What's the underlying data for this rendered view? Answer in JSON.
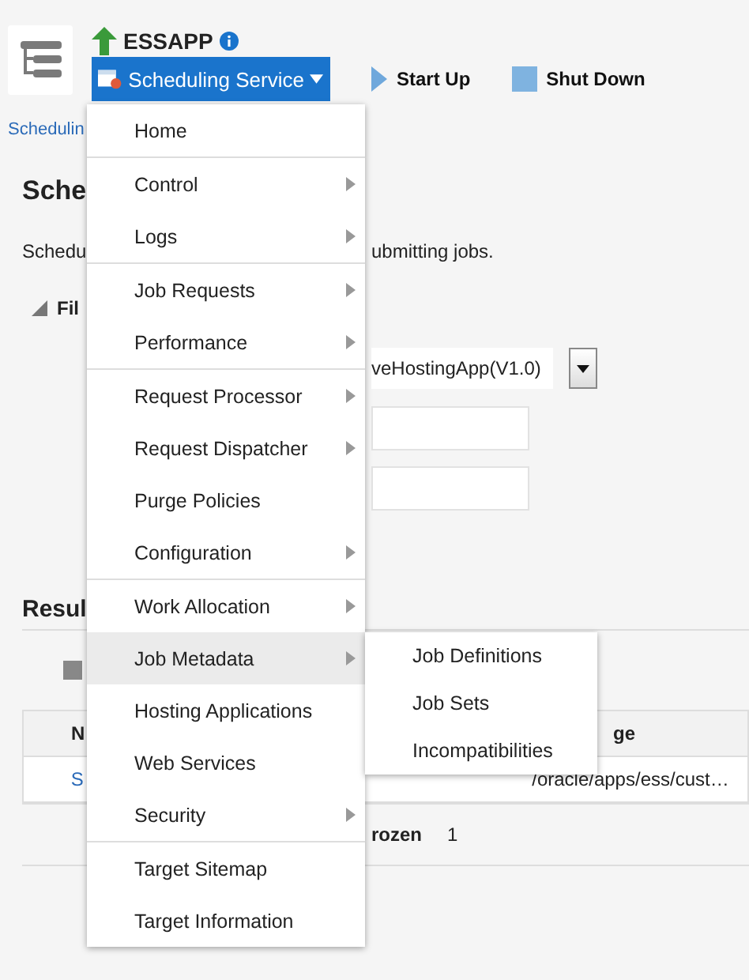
{
  "header": {
    "app_title": "ESSAPP",
    "service_button": "Scheduling Service",
    "actions": [
      {
        "kind": "start",
        "label": "Start Up"
      },
      {
        "kind": "stop",
        "label": "Shut Down"
      }
    ]
  },
  "breadcrumb": "Schedulin",
  "page_title": "Sche",
  "description": {
    "left": "Schedu",
    "right": "ubmitting jobs."
  },
  "filter": {
    "label": "Fil",
    "expanded": true,
    "select_value": "veHostingApp(V1.0)"
  },
  "results": {
    "title": "Resul",
    "headers": [
      "N",
      "ge"
    ],
    "row": [
      "S",
      "/oracle/apps/ess/cust…"
    ],
    "footer": [
      "rozen",
      "1"
    ]
  },
  "menu": {
    "groups": [
      [
        {
          "label": "Home",
          "submenu": false,
          "selected": false
        }
      ],
      [
        {
          "label": "Control",
          "submenu": true,
          "selected": false
        },
        {
          "label": "Logs",
          "submenu": true,
          "selected": false
        }
      ],
      [
        {
          "label": "Job Requests",
          "submenu": true,
          "selected": false
        },
        {
          "label": "Performance",
          "submenu": true,
          "selected": false
        }
      ],
      [
        {
          "label": "Request Processor",
          "submenu": true,
          "selected": false
        },
        {
          "label": "Request Dispatcher",
          "submenu": true,
          "selected": false
        },
        {
          "label": "Purge Policies",
          "submenu": false,
          "selected": false
        },
        {
          "label": "Configuration",
          "submenu": true,
          "selected": false
        }
      ],
      [
        {
          "label": "Work Allocation",
          "submenu": true,
          "selected": false
        },
        {
          "label": "Job Metadata",
          "submenu": true,
          "selected": true
        },
        {
          "label": "Hosting Applications",
          "submenu": false,
          "selected": false
        },
        {
          "label": "Web Services",
          "submenu": false,
          "selected": false
        },
        {
          "label": "Security",
          "submenu": true,
          "selected": false
        }
      ],
      [
        {
          "label": "Target Sitemap",
          "submenu": false,
          "selected": false
        },
        {
          "label": "Target Information",
          "submenu": false,
          "selected": false
        }
      ]
    ],
    "submenu": [
      "Job Definitions",
      "Job Sets",
      "Incompatibilities"
    ]
  }
}
